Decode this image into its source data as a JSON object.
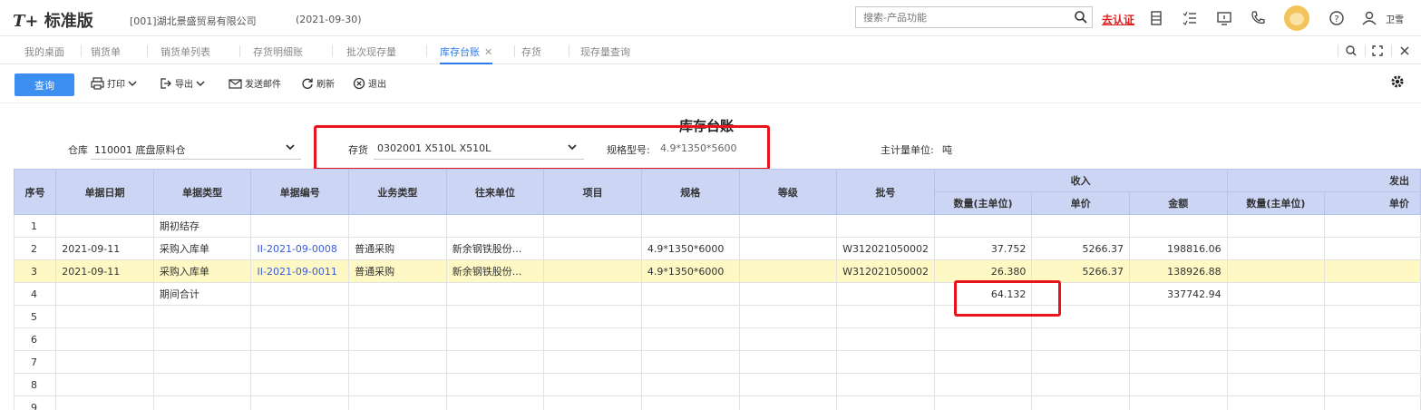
{
  "app": {
    "logo_prefix": "T+",
    "logo_text": "标准版",
    "company": "[001]湖北景盛贸易有限公司",
    "date": "(2021-09-30)",
    "search_placeholder": "搜索-产品功能",
    "certify_label": "去认证",
    "username": "卫雪"
  },
  "tabs": [
    {
      "label": "我的桌面"
    },
    {
      "label": "销货单"
    },
    {
      "label": "销货单列表"
    },
    {
      "label": "存货明细账"
    },
    {
      "label": "批次现存量"
    },
    {
      "label": "库存台账",
      "active": true
    },
    {
      "label": "存货"
    },
    {
      "label": "现存量查询"
    }
  ],
  "toolbar": {
    "query": "查询",
    "print": "打印",
    "export": "导出",
    "email": "发送邮件",
    "refresh": "刷新",
    "exit": "退出"
  },
  "report": {
    "title": "库存台账",
    "warehouse_label": "仓库",
    "warehouse_value": "110001 底盘原料仓",
    "inventory_label": "存货",
    "inventory_value": "0302001 X510L X510L",
    "spec_label": "规格型号:",
    "spec_value": "4.9*1350*5600",
    "unit_label": "主计量单位:",
    "unit_value": "吨"
  },
  "table": {
    "headers": {
      "index": "序号",
      "doc_date": "单据日期",
      "doc_type": "单据类型",
      "doc_no": "单据编号",
      "biz_type": "业务类型",
      "partner": "往来单位",
      "project": "项目",
      "spec": "规格",
      "grade": "等级",
      "batch": "批号",
      "income": "收入",
      "outgo": "发出",
      "in_qty": "数量(主单位)",
      "in_price": "单价",
      "in_amount": "金额",
      "out_qty": "数量(主单位)",
      "out_price": "单价"
    },
    "rows": [
      {
        "idx": "1",
        "date": "",
        "type": "期初结存",
        "no": "",
        "biz": "",
        "partner": "",
        "project": "",
        "spec": "",
        "grade": "",
        "batch": "",
        "in_qty": "",
        "in_price": "",
        "in_amount": "",
        "out_qty": "",
        "out_price": ""
      },
      {
        "idx": "2",
        "date": "2021-09-11",
        "type": "采购入库单",
        "no": "II-2021-09-0008",
        "biz": "普通采购",
        "partner": "新余钢铁股份...",
        "project": "",
        "spec": "4.9*1350*6000",
        "grade": "",
        "batch": "W312021050002",
        "in_qty": "37.752",
        "in_price": "5266.37",
        "in_amount": "198816.06",
        "out_qty": "",
        "out_price": ""
      },
      {
        "idx": "3",
        "date": "2021-09-11",
        "type": "采购入库单",
        "no": "II-2021-09-0011",
        "biz": "普通采购",
        "partner": "新余钢铁股份...",
        "project": "",
        "spec": "4.9*1350*6000",
        "grade": "",
        "batch": "W312021050002",
        "in_qty": "26.380",
        "in_price": "5266.37",
        "in_amount": "138926.88",
        "out_qty": "",
        "out_price": ""
      },
      {
        "idx": "4",
        "date": "",
        "type": "期间合计",
        "no": "",
        "biz": "",
        "partner": "",
        "project": "",
        "spec": "",
        "grade": "",
        "batch": "",
        "in_qty": "64.132",
        "in_price": "",
        "in_amount": "337742.94",
        "out_qty": "",
        "out_price": ""
      },
      {
        "idx": "5"
      },
      {
        "idx": "6"
      },
      {
        "idx": "7"
      },
      {
        "idx": "8"
      },
      {
        "idx": "9"
      }
    ]
  },
  "colors": {
    "accent": "#3c8ef0",
    "header_bg": "#cdd5f5",
    "highlight_row": "#fdf8c4",
    "annotation_red": "#e8141b"
  }
}
